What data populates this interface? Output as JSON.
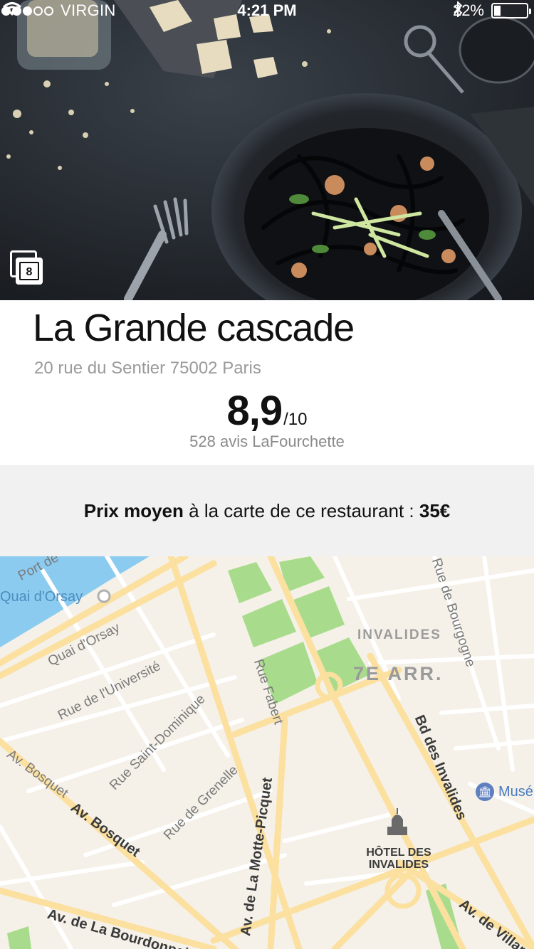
{
  "status_bar": {
    "carrier": "VIRGIN",
    "time": "4:21 PM",
    "battery": "22%",
    "battery_level": 0.22
  },
  "hero": {
    "photo_count": "8"
  },
  "restaurant": {
    "name": "La Grande cascade",
    "address": "20 rue du Sentier 75002 Paris",
    "score": "8,9",
    "score_max": "/10",
    "reviews": "528 avis LaFourchette"
  },
  "price": {
    "label_bold": "Prix moyen",
    "label_rest": " à la carte de ce restaurant : ",
    "value": "35€"
  },
  "map": {
    "streets": {
      "port": "Port de",
      "quai_dorsay_top": "Quai d'Orsay",
      "quai_dorsay": "Quai d'Orsay",
      "universite": "Rue de l'Université",
      "saint_dominique": "Rue Saint-Dominique",
      "grenelle": "Rue de Grenelle",
      "fabert": "Rue Fabert",
      "bourgogne": "Rue de Bourgogne",
      "bosquet_small": "Av. Bosquet",
      "bosquet": "Av. Bosquet",
      "motte_picquet": "Av. de La Motte-Picquet",
      "bourdonnais": "Av. de La Bourdonnais",
      "invalides_bd": "Bd des Invalides",
      "villars": "Av. de Villars"
    },
    "district": "7E ARR.",
    "quarter": "INVALIDES",
    "poi": "HÔTEL DES INVALIDES",
    "museum": "Musé",
    "colors": {
      "water": "#8ccbf0",
      "park": "#a8dc8c",
      "major_road": "#fbe0a0",
      "minor_road": "#ffffff",
      "land": "#f5f1e8"
    }
  }
}
